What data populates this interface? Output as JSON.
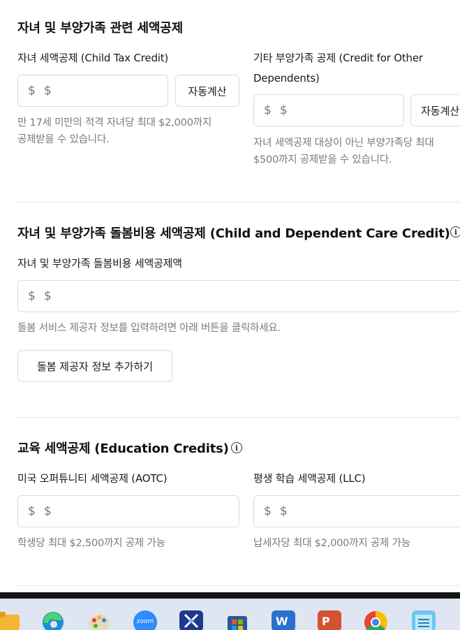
{
  "section1": {
    "title": "자녀 및 부양가족 관련 세액공제",
    "child_credit": {
      "label": "자녀 세액공제 (Child Tax Credit)",
      "currency": "$",
      "placeholder": "$",
      "button": "자동계산",
      "help": [
        "만 17세 미만의 적격 자녀당 최대 $2,000까지",
        "공제받을 수 있습니다."
      ]
    },
    "other_dependents": {
      "label": [
        "기타 부양가족 공제 (Credit for Other",
        "Dependents)"
      ],
      "currency": "$",
      "placeholder": "$",
      "button": "자동계산",
      "help": [
        "자녀 세액공제 대상이 아닌 부양가족당 최대",
        "$500까지 공제받을 수 있습니다."
      ]
    }
  },
  "section2": {
    "title": "자녀 및 부양가족 돌봄비용 세액공제 (Child and Dependent Care Credit)",
    "label": "자녀 및 부양가족 돌봄비용 세액공제액",
    "currency": "$",
    "placeholder": "$",
    "help": "돌봄 서비스 제공자 정보를 입력하려면 아래 버튼을 클릭하세요.",
    "button": "돌봄 제공자 정보 추가하기"
  },
  "section3": {
    "title": "교육 세액공제 (Education Credits)",
    "aotc": {
      "label": "미국 오퍼튜니티 세액공제 (AOTC)",
      "currency": "$",
      "placeholder": "$",
      "help": "학생당 최대 $2,500까지 공제 가능"
    },
    "llc": {
      "label": "평생 학습 세액공제 (LLC)",
      "currency": "$",
      "placeholder": "$",
      "help": "납세자당 최대 $2,000까지 공제 가능"
    }
  },
  "taskbar": {
    "icons": [
      "folder-icon",
      "edge-icon",
      "paint-icon",
      "zoom-icon",
      "snipping-tool-icon",
      "store-icon",
      "word-icon",
      "powerpoint-icon",
      "chrome-icon",
      "notepad-icon"
    ],
    "zoom_label": "zoom",
    "word_label": "W",
    "powerpoint_label": "P"
  }
}
